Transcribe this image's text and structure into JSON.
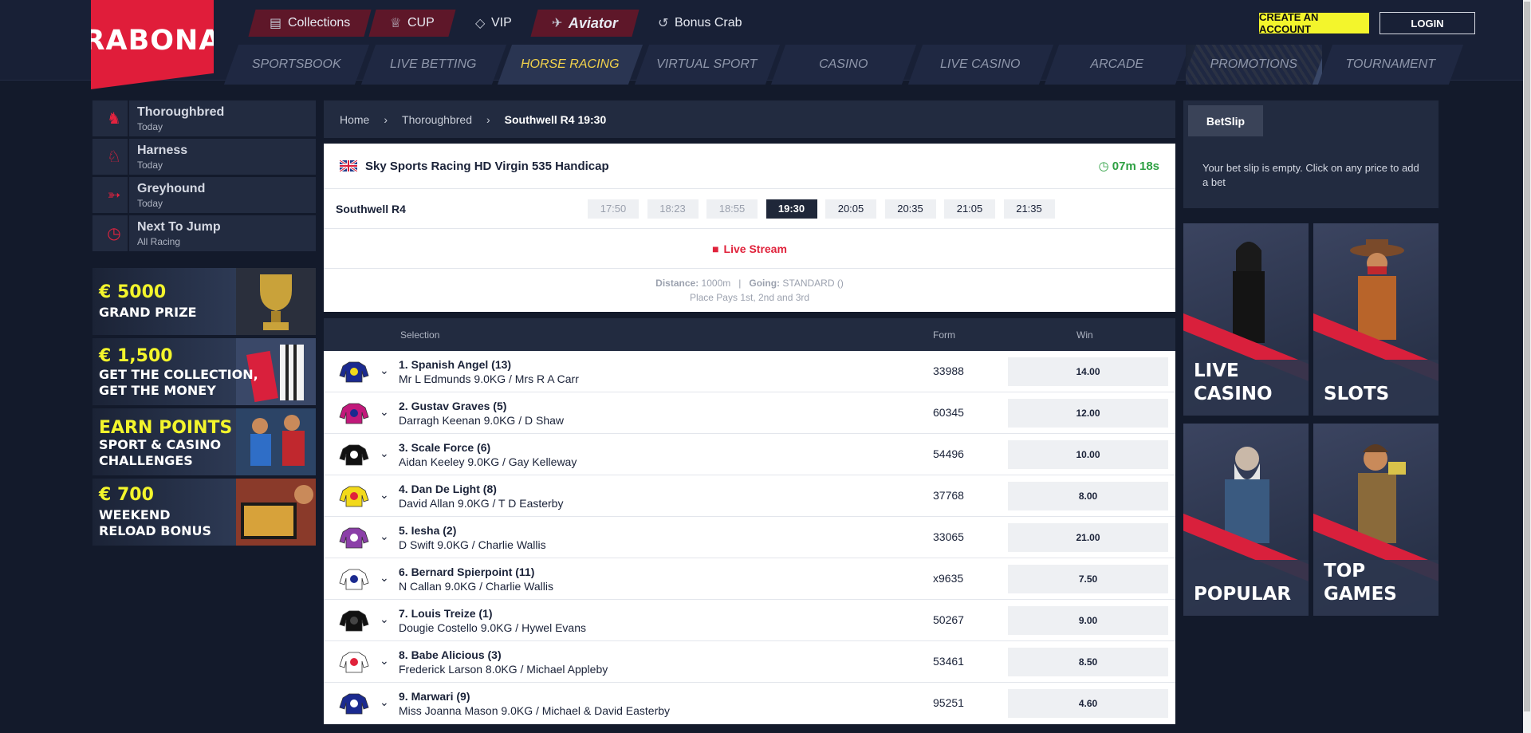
{
  "brand": {
    "logo": "RABONA"
  },
  "topnav": [
    {
      "label": "Collections",
      "icon": "book-icon"
    },
    {
      "label": "CUP",
      "icon": "trophy-icon"
    },
    {
      "label": "VIP",
      "icon": "diamond-icon"
    },
    {
      "label": "Aviator",
      "icon": "plane-icon"
    },
    {
      "label": "Bonus Crab",
      "icon": "claw-icon"
    }
  ],
  "auth": {
    "create": "CREATE AN ACCOUNT",
    "login": "LOGIN"
  },
  "mainnav": [
    "SPORTSBOOK",
    "LIVE BETTING",
    "HORSE RACING",
    "VIRTUAL SPORT",
    "CASINO",
    "LIVE CASINO",
    "ARCADE",
    "PROMOTIONS",
    "TOURNAMENT"
  ],
  "sidebar": [
    {
      "title": "Thoroughbred",
      "sub": "Today",
      "icon": "horse-icon"
    },
    {
      "title": "Harness",
      "sub": "Today",
      "icon": "harness-icon"
    },
    {
      "title": "Greyhound",
      "sub": "Today",
      "icon": "greyhound-icon"
    },
    {
      "title": "Next To Jump",
      "sub": "All Racing",
      "icon": "clock-icon"
    }
  ],
  "promos": [
    {
      "line1": "€ 5000",
      "line2": "GRAND PRIZE",
      "line3": ""
    },
    {
      "line1": "€ 1,500",
      "line2": "GET THE COLLECTION,",
      "line3": "GET THE MONEY"
    },
    {
      "line1": "EARN POINTS",
      "line2": "SPORT & CASINO",
      "line3": "CHALLENGES"
    },
    {
      "line1": "€ 700",
      "line2": "WEEKEND",
      "line3": "RELOAD BONUS"
    }
  ],
  "breadcrumb": [
    "Home",
    "Thoroughbred",
    "Southwell R4 19:30"
  ],
  "race": {
    "name": "Sky Sports Racing HD Virgin 535 Handicap",
    "countdown": "07m 18s",
    "venue": "Southwell R4",
    "times": [
      {
        "t": "17:50",
        "state": "past"
      },
      {
        "t": "18:23",
        "state": "past"
      },
      {
        "t": "18:55",
        "state": "past"
      },
      {
        "t": "19:30",
        "state": "current"
      },
      {
        "t": "20:05",
        "state": "future"
      },
      {
        "t": "20:35",
        "state": "future"
      },
      {
        "t": "21:05",
        "state": "future"
      },
      {
        "t": "21:35",
        "state": "future"
      }
    ],
    "live_stream": "Live Stream",
    "distance_label": "Distance:",
    "distance": "1000m",
    "going_label": "Going:",
    "going": "STANDARD ()",
    "place": "Place Pays 1st, 2nd and 3rd"
  },
  "table": {
    "headers": {
      "selection": "Selection",
      "form": "Form",
      "win": "Win"
    },
    "runners": [
      {
        "name": "1. Spanish Angel (13)",
        "jockey": "Mr L Edmunds 9.0KG / Mrs R A Carr",
        "form": "33988",
        "win": "14.00",
        "silk": [
          "#1b2a8f",
          "#f2d91a"
        ]
      },
      {
        "name": "2. Gustav Graves (5)",
        "jockey": "Darragh Keenan 9.0KG / D Shaw",
        "form": "60345",
        "win": "12.00",
        "silk": [
          "#c2197b",
          "#1b2a8f"
        ]
      },
      {
        "name": "3. Scale Force (6)",
        "jockey": "Aidan Keeley 9.0KG / Gay Kelleway",
        "form": "54496",
        "win": "10.00",
        "silk": [
          "#111111",
          "#ffffff"
        ]
      },
      {
        "name": "4. Dan De Light (8)",
        "jockey": "David Allan 9.0KG / T D Easterby",
        "form": "37768",
        "win": "8.00",
        "silk": [
          "#f2d91a",
          "#e0223b"
        ]
      },
      {
        "name": "5. Iesha (2)",
        "jockey": "D Swift 9.0KG / Charlie Wallis",
        "form": "33065",
        "win": "21.00",
        "silk": [
          "#8b3fa8",
          "#ffffff"
        ]
      },
      {
        "name": "6. Bernard Spierpoint (11)",
        "jockey": "N Callan 9.0KG / Charlie Wallis",
        "form": "x9635",
        "win": "7.50",
        "silk": [
          "#ffffff",
          "#1b2a8f"
        ]
      },
      {
        "name": "7. Louis Treize (1)",
        "jockey": "Dougie Costello 9.0KG / Hywel Evans",
        "form": "50267",
        "win": "9.00",
        "silk": [
          "#111111",
          "#444444"
        ]
      },
      {
        "name": "8. Babe Alicious (3)",
        "jockey": "Frederick Larson 8.0KG / Michael Appleby",
        "form": "53461",
        "win": "8.50",
        "silk": [
          "#ffffff",
          "#e0223b"
        ]
      },
      {
        "name": "9. Marwari (9)",
        "jockey": "Miss Joanna Mason 9.0KG / Michael & David Easterby",
        "form": "95251",
        "win": "4.60",
        "silk": [
          "#1b2a8f",
          "#ffffff"
        ]
      }
    ]
  },
  "betslip": {
    "tab": "BetSlip",
    "empty": "Your bet slip is empty. Click on any price to add a bet"
  },
  "tiles": [
    {
      "line1": "LIVE",
      "line2": "CASINO"
    },
    {
      "line1": "SLOTS",
      "line2": ""
    },
    {
      "line1": "POPULAR",
      "line2": ""
    },
    {
      "line1": "TOP GAMES",
      "line2": ""
    }
  ],
  "colors": {
    "accent": "#e01d3a",
    "yellow": "#f3f52c",
    "nav_active": "#f2d24b",
    "timer": "#2ea043",
    "bg": "#131a2b"
  }
}
